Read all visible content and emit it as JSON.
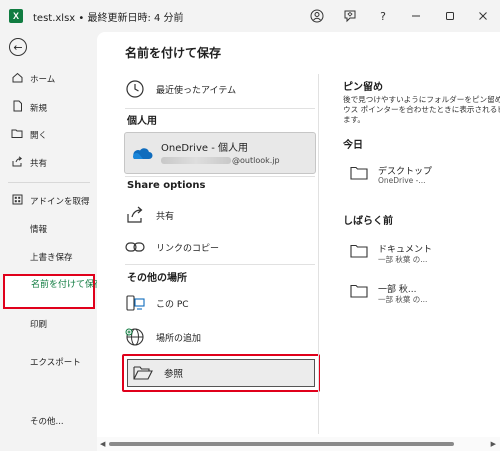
{
  "titlebar": {
    "app_logo": "X",
    "title": "test.xlsx • 最終更新日時: 4 分前",
    "icons": [
      "avatar-icon",
      "feedback-icon",
      "help-icon",
      "minimize-icon",
      "maximize-icon",
      "close-icon"
    ],
    "help": "?"
  },
  "sidebar": {
    "back": "←",
    "items": [
      {
        "label": "ホーム",
        "icon": "home-icon"
      },
      {
        "label": "新規",
        "icon": "new-file-icon"
      },
      {
        "label": "開く",
        "icon": "open-folder-icon"
      },
      {
        "label": "共有",
        "icon": "share-icon"
      },
      {
        "label": "アドインを取得",
        "icon": "addin-grid-icon"
      },
      {
        "label": "情報"
      },
      {
        "label": "上書き保存"
      },
      {
        "label": "名前を付けて保存",
        "active": true
      },
      {
        "label": "印刷"
      },
      {
        "label": "エクスポート"
      },
      {
        "label": "その他..."
      }
    ]
  },
  "main": {
    "title": "名前を付けて保存",
    "recent": "最近使ったアイテム",
    "personal_header": "個人用",
    "onedrive": {
      "title": "OneDrive - 個人用",
      "email_suffix": "@outlook.jp"
    },
    "share_header": "Share options",
    "share": "共有",
    "copy_link": "リンクのコピー",
    "other_header": "その他の場所",
    "this_pc": "この PC",
    "add_place": "場所の追加",
    "browse": "参照"
  },
  "right": {
    "pinned_header": "ピン留め",
    "pinned_desc": "後で見つけやすいようにフォルダーをピン留めします\nウス ポインターを合わせたときに表示されるピン\nます。",
    "today_header": "今日",
    "today_items": [
      {
        "name": "デスクトップ",
        "sub": "OneDrive -..."
      }
    ],
    "recent_header": "しばらく前",
    "recent_items": [
      {
        "name": "ドキュメント",
        "sub": "一部 秋葉 の..."
      },
      {
        "name": "一部 秋...",
        "sub": "一部 秋葉 の..."
      }
    ]
  },
  "colors": {
    "excel_green": "#107c41",
    "highlight_red": "#e0001b",
    "onedrive_blue": "#0f6cbd"
  }
}
